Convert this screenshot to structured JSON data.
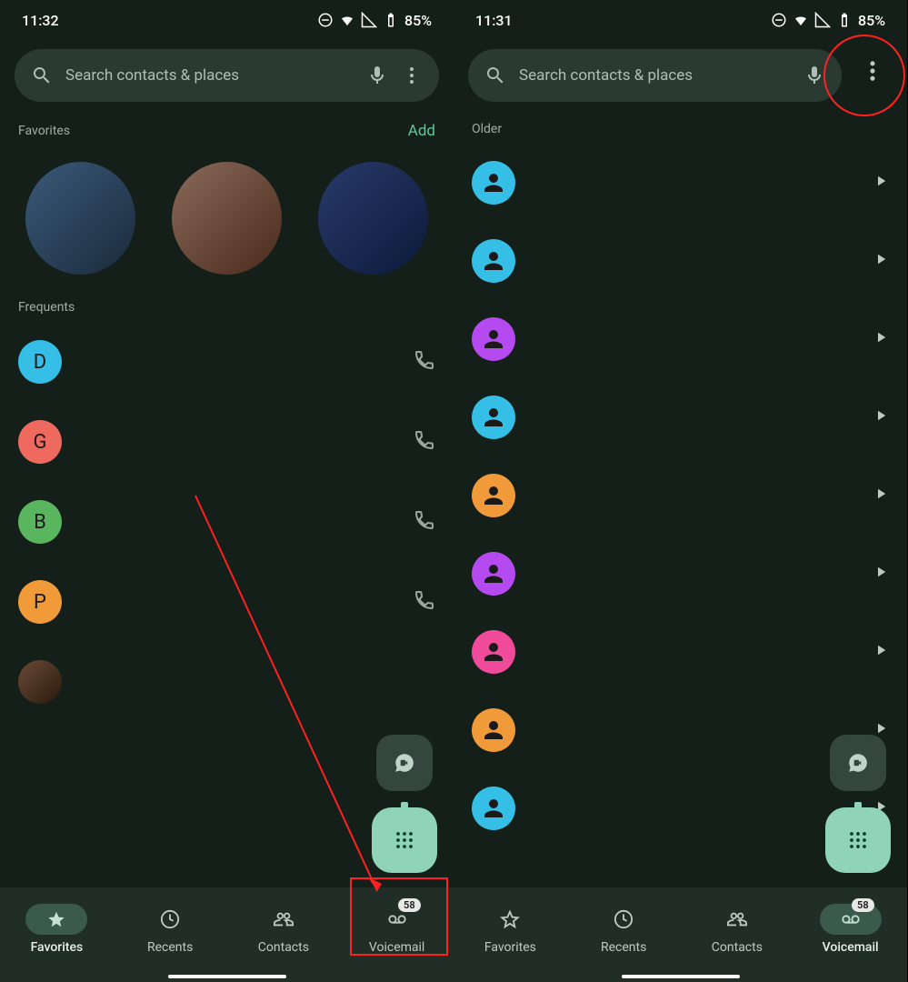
{
  "left": {
    "status": {
      "time": "11:32",
      "battery": "85%"
    },
    "search_placeholder": "Search contacts & places",
    "favorites_label": "Favorites",
    "add_label": "Add",
    "frequents_label": "Frequents",
    "frequents": [
      {
        "letter": "D",
        "color": "#35bfe6"
      },
      {
        "letter": "G",
        "color": "#ee6a5f"
      },
      {
        "letter": "B",
        "color": "#5ab55f"
      },
      {
        "letter": "P",
        "color": "#f09a3a"
      },
      {
        "letter": "",
        "color": "photo"
      }
    ],
    "nav": {
      "favorites": "Favorites",
      "recents": "Recents",
      "contacts": "Contacts",
      "voicemail": "Voicemail",
      "voicemail_badge": "58",
      "active": "favorites"
    }
  },
  "right": {
    "status": {
      "time": "11:31",
      "battery": "85%"
    },
    "search_placeholder": "Search contacts & places",
    "older_label": "Older",
    "older_items": [
      {
        "color": "#35bfe6"
      },
      {
        "color": "#35bfe6"
      },
      {
        "color": "#b44af0"
      },
      {
        "color": "#35bfe6"
      },
      {
        "color": "#f09a3a"
      },
      {
        "color": "#b44af0"
      },
      {
        "color": "#f04a9a"
      },
      {
        "color": "#f09a3a"
      },
      {
        "color": "#35bfe6"
      }
    ],
    "nav": {
      "favorites": "Favorites",
      "recents": "Recents",
      "contacts": "Contacts",
      "voicemail": "Voicemail",
      "voicemail_badge": "58",
      "active": "voicemail"
    }
  }
}
